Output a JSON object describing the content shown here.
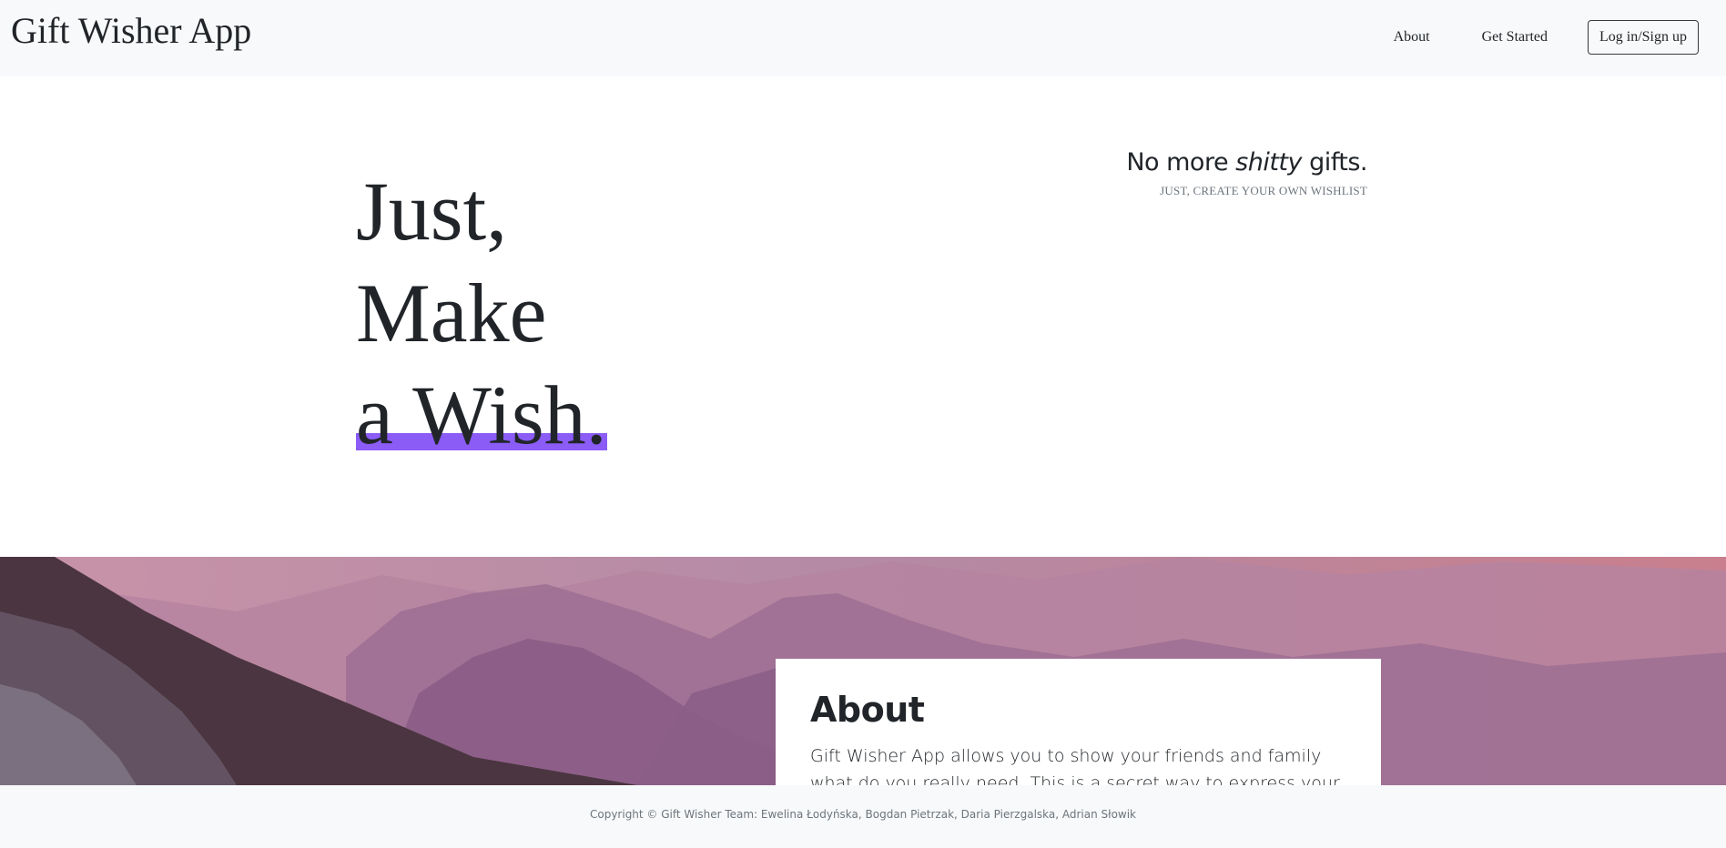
{
  "navbar": {
    "brand": "Gift Wisher App",
    "links": [
      "About",
      "Get Started"
    ],
    "login_label": "Log in/Sign up"
  },
  "hero": {
    "lines": [
      "Just,",
      "Make",
      "a Wish."
    ],
    "tagline_prefix": "No more ",
    "tagline_emphasis": "shitty",
    "tagline_suffix": " gifts.",
    "subtitle": "JUST, CREATE YOUR OWN WISHLIST",
    "highlight_color": "#8b5cf6"
  },
  "about": {
    "title": "About",
    "text": "Gift Wisher App allows you to show your friends and family what do you really need. This is a secret way to express your list and monitor wishes"
  },
  "footer": {
    "copyright": "Copyright © Gift Wisher Team: Ewelina Łodyńska, Bogdan Pietrzak, Daria Pierzgalska, Adrian Słowik"
  }
}
